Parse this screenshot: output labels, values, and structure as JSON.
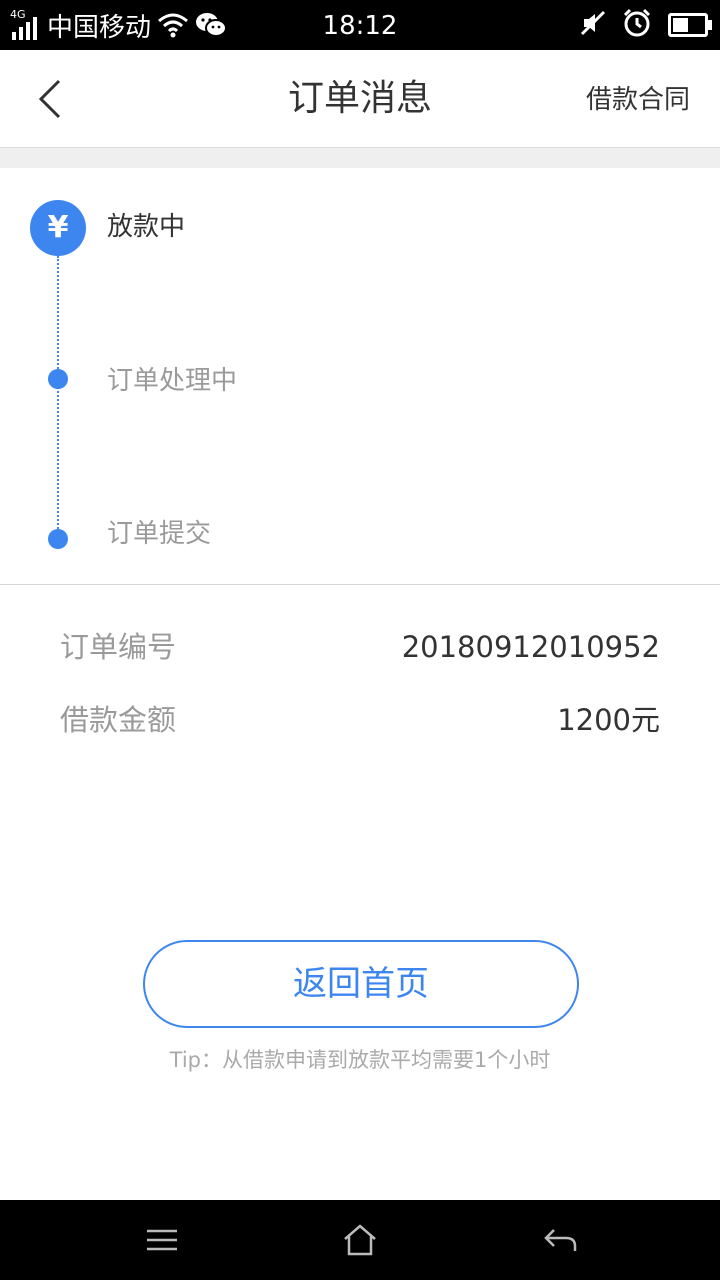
{
  "status_bar": {
    "network": "4G",
    "carrier": "中国移动",
    "time": "18:12"
  },
  "header": {
    "title": "订单消息",
    "contract_link": "借款合同"
  },
  "timeline": {
    "icon_symbol": "¥",
    "steps": [
      {
        "label": "放款中"
      },
      {
        "label": "订单处理中"
      },
      {
        "label": "订单提交"
      }
    ]
  },
  "details": {
    "order_number_label": "订单编号",
    "order_number_value": "20180912010952",
    "loan_amount_label": "借款金额",
    "loan_amount_value": "1200元"
  },
  "actions": {
    "home_button": "返回首页"
  },
  "tip": "Tip：从借款申请到放款平均需要1个小时",
  "colors": {
    "accent": "#3d86f0",
    "text_primary": "#333333",
    "text_secondary": "#9a9a9a"
  },
  "icons": [
    "wifi-icon",
    "wechat-icon",
    "mute-icon",
    "alarm-icon",
    "battery-icon",
    "back-arrow-icon",
    "yen-icon",
    "menu-icon",
    "home-icon",
    "return-icon"
  ]
}
